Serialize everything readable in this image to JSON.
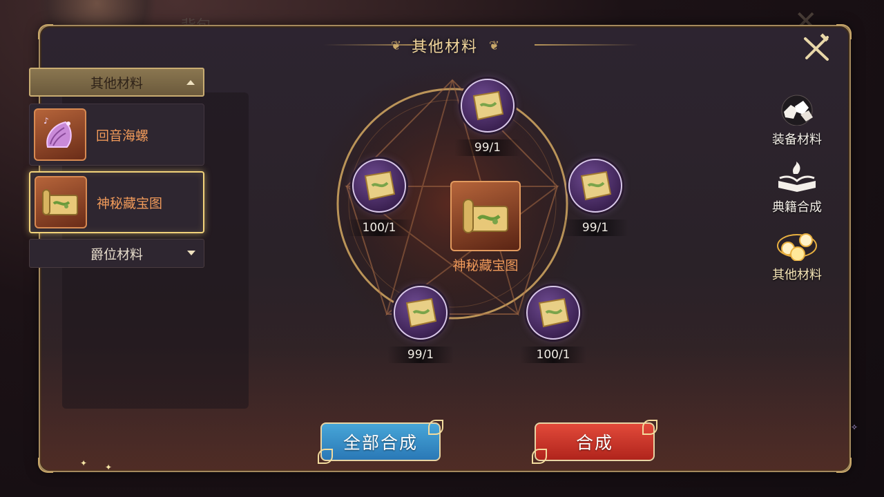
{
  "background": {
    "ghost_title": "背包"
  },
  "panel": {
    "title": "其他材料"
  },
  "left_list": {
    "open_category": "其他材料",
    "items": [
      {
        "label": "回音海螺",
        "icon": "conch-shell-icon"
      },
      {
        "label": "神秘藏宝图",
        "icon": "treasure-map-icon",
        "selected": true
      }
    ],
    "closed_category": "爵位材料"
  },
  "recipe": {
    "result_label": "神秘藏宝图",
    "result_icon": "treasure-map-scroll-icon",
    "materials": [
      {
        "count": "99/1",
        "icon": "map-fragment-icon"
      },
      {
        "count": "99/1",
        "icon": "map-fragment-icon"
      },
      {
        "count": "100/1",
        "icon": "map-fragment-icon"
      },
      {
        "count": "99/1",
        "icon": "map-fragment-icon"
      },
      {
        "count": "100/1",
        "icon": "map-fragment-icon"
      }
    ]
  },
  "side_tabs": [
    {
      "label": "装备材料",
      "icon": "ore-chunks-icon"
    },
    {
      "label": "典籍合成",
      "icon": "open-book-icon"
    },
    {
      "label": "其他材料",
      "icon": "golden-orbs-icon",
      "active": true
    }
  ],
  "buttons": {
    "synthesize_all": "全部合成",
    "synthesize": "合成"
  },
  "colors": {
    "accent_gold": "#f1d69c",
    "item_label_orange": "#f09a5a",
    "button_blue": "#3a8ec8",
    "button_red": "#cc3428",
    "node_purple": "#5a3a7a"
  }
}
